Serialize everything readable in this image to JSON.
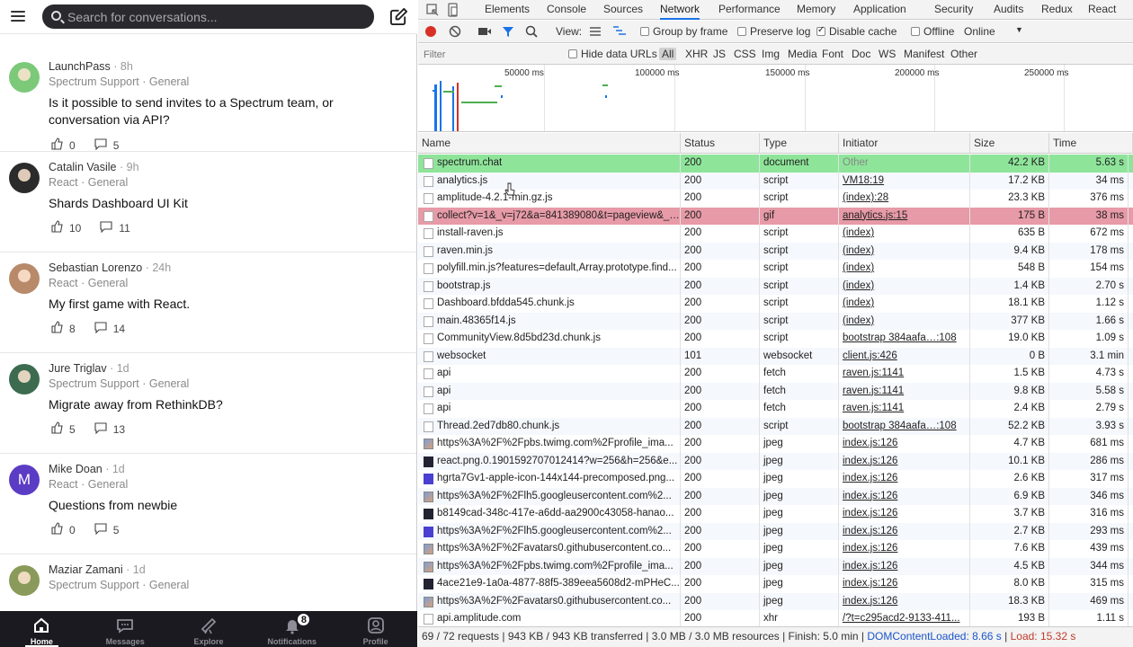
{
  "app": {
    "search_placeholder": "Search for conversations...",
    "threads": [
      {
        "author": "LaunchPass",
        "ago": "8h",
        "channel": "Spectrum Support · General",
        "title": "Is it possible to send invites to a Spectrum team, or conversation via API?",
        "likes": "0",
        "comments": "5",
        "avatar_color": "#7cc97a"
      },
      {
        "author": "Catalin Vasile",
        "ago": "9h",
        "channel": "React · General",
        "title": "Shards Dashboard UI Kit",
        "likes": "10",
        "comments": "11",
        "avatar_color": "#2b2b2b"
      },
      {
        "author": "Sebastian Lorenzo",
        "ago": "24h",
        "channel": "React · General",
        "title": "My first game with React.",
        "likes": "8",
        "comments": "14",
        "avatar_color": "#b88a6a"
      },
      {
        "author": "Jure Triglav",
        "ago": "1d",
        "channel": "Spectrum Support · General",
        "title": "Migrate away from RethinkDB?",
        "likes": "5",
        "comments": "13",
        "avatar_color": "#3d6b4f"
      },
      {
        "author": "Mike Doan",
        "ago": "1d",
        "channel": "React · General",
        "title": "Questions from newbie",
        "likes": "0",
        "comments": "5",
        "avatar_color": "#5b3cc4",
        "initial": "M"
      },
      {
        "author": "Maziar Zamani",
        "ago": "1d",
        "channel": "Spectrum Support · General",
        "title": "",
        "likes": "",
        "comments": "",
        "avatar_color": "#8a9a5a"
      }
    ],
    "nav": [
      {
        "label": "Home",
        "icon": "home-icon"
      },
      {
        "label": "Messages",
        "icon": "messages-icon"
      },
      {
        "label": "Explore",
        "icon": "explore-icon"
      },
      {
        "label": "Notifications",
        "icon": "notifications-icon",
        "badge": "8"
      },
      {
        "label": "Profile",
        "icon": "profile-icon"
      }
    ]
  },
  "devtools": {
    "tabs": [
      "Elements",
      "Console",
      "Sources",
      "Network",
      "Performance",
      "Memory",
      "Application",
      "Security",
      "Audits",
      "Redux",
      "React"
    ],
    "active_tab": "Network",
    "toolbar": {
      "view_label": "View:",
      "group_by_frame": "Group by frame",
      "preserve_log": "Preserve log",
      "disable_cache": "Disable cache",
      "offline": "Offline",
      "throttle": "Online"
    },
    "filter": {
      "placeholder": "Filter",
      "hide_data_urls": "Hide data URLs",
      "types": [
        "All",
        "XHR",
        "JS",
        "CSS",
        "Img",
        "Media",
        "Font",
        "Doc",
        "WS",
        "Manifest",
        "Other"
      ]
    },
    "overview_ticks": [
      "50000 ms",
      "100000 ms",
      "150000 ms",
      "200000 ms",
      "250000 ms"
    ],
    "columns": {
      "name": "Name",
      "status": "Status",
      "type": "Type",
      "initiator": "Initiator",
      "size": "Size",
      "time": "Time"
    },
    "rows": [
      {
        "name": "spectrum.chat",
        "status": "200",
        "type": "document",
        "initiator": "Other",
        "size": "42.2 KB",
        "time": "5.63 s",
        "hl": "green"
      },
      {
        "name": "analytics.js",
        "status": "200",
        "type": "script",
        "initiator": "VM18:19",
        "size": "17.2 KB",
        "time": "34 ms"
      },
      {
        "name": "amplitude-4.2.1-min.gz.js",
        "status": "200",
        "type": "script",
        "initiator": "(index):28",
        "size": "23.3 KB",
        "time": "376 ms"
      },
      {
        "name": "collect?v=1&_v=j72&a=841389080&t=pageview&_…",
        "status": "200",
        "type": "gif",
        "initiator": "analytics.js:15",
        "size": "175 B",
        "time": "38 ms",
        "hl": "red"
      },
      {
        "name": "install-raven.js",
        "status": "200",
        "type": "script",
        "initiator": "(index)",
        "size": "635 B",
        "time": "672 ms"
      },
      {
        "name": "raven.min.js",
        "status": "200",
        "type": "script",
        "initiator": "(index)",
        "size": "9.4 KB",
        "time": "178 ms"
      },
      {
        "name": "polyfill.min.js?features=default,Array.prototype.find...",
        "status": "200",
        "type": "script",
        "initiator": "(index)",
        "size": "548 B",
        "time": "154 ms"
      },
      {
        "name": "bootstrap.js",
        "status": "200",
        "type": "script",
        "initiator": "(index)",
        "size": "1.4 KB",
        "time": "2.70 s"
      },
      {
        "name": "Dashboard.bfdda545.chunk.js",
        "status": "200",
        "type": "script",
        "initiator": "(index)",
        "size": "18.1 KB",
        "time": "1.12 s"
      },
      {
        "name": "main.48365f14.js",
        "status": "200",
        "type": "script",
        "initiator": "(index)",
        "size": "377 KB",
        "time": "1.66 s"
      },
      {
        "name": "CommunityView.8d5bd23d.chunk.js",
        "status": "200",
        "type": "script",
        "initiator": "bootstrap 384aafa…:108",
        "size": "19.0 KB",
        "time": "1.09 s"
      },
      {
        "name": "websocket",
        "status": "101",
        "type": "websocket",
        "initiator": "client.js:426",
        "size": "0 B",
        "time": "3.1 min"
      },
      {
        "name": "api",
        "status": "200",
        "type": "fetch",
        "initiator": "raven.js:1141",
        "size": "1.5 KB",
        "time": "4.73 s"
      },
      {
        "name": "api",
        "status": "200",
        "type": "fetch",
        "initiator": "raven.js:1141",
        "size": "9.8 KB",
        "time": "5.58 s"
      },
      {
        "name": "api",
        "status": "200",
        "type": "fetch",
        "initiator": "raven.js:1141",
        "size": "2.4 KB",
        "time": "2.79 s"
      },
      {
        "name": "Thread.2ed7db80.chunk.js",
        "status": "200",
        "type": "script",
        "initiator": "bootstrap 384aafa…:108",
        "size": "52.2 KB",
        "time": "3.93 s"
      },
      {
        "name": "https%3A%2F%2Fpbs.twimg.com%2Fprofile_ima...",
        "status": "200",
        "type": "jpeg",
        "initiator": "index.js:126",
        "size": "4.7 KB",
        "time": "681 ms",
        "icon": "img"
      },
      {
        "name": "react.png.0.1901592707012414?w=256&h=256&e...",
        "status": "200",
        "type": "jpeg",
        "initiator": "index.js:126",
        "size": "10.1 KB",
        "time": "286 ms",
        "icon": "dark"
      },
      {
        "name": "hgrta7Gv1-apple-icon-144x144-precomposed.png...",
        "status": "200",
        "type": "jpeg",
        "initiator": "index.js:126",
        "size": "2.6 KB",
        "time": "317 ms",
        "icon": "blue"
      },
      {
        "name": "https%3A%2F%2Flh5.googleusercontent.com%2...",
        "status": "200",
        "type": "jpeg",
        "initiator": "index.js:126",
        "size": "6.9 KB",
        "time": "346 ms",
        "icon": "img"
      },
      {
        "name": "b8149cad-348c-417e-a6dd-aa2900c43058-hanao...",
        "status": "200",
        "type": "jpeg",
        "initiator": "index.js:126",
        "size": "3.7 KB",
        "time": "316 ms",
        "icon": "dark"
      },
      {
        "name": "https%3A%2F%2Flh5.googleusercontent.com%2...",
        "status": "200",
        "type": "jpeg",
        "initiator": "index.js:126",
        "size": "2.7 KB",
        "time": "293 ms",
        "icon": "blue"
      },
      {
        "name": "https%3A%2F%2Favatars0.githubusercontent.co...",
        "status": "200",
        "type": "jpeg",
        "initiator": "index.js:126",
        "size": "7.6 KB",
        "time": "439 ms",
        "icon": "img"
      },
      {
        "name": "https%3A%2F%2Fpbs.twimg.com%2Fprofile_ima...",
        "status": "200",
        "type": "jpeg",
        "initiator": "index.js:126",
        "size": "4.5 KB",
        "time": "344 ms",
        "icon": "img"
      },
      {
        "name": "4ace21e9-1a0a-4877-88f5-389eea5608d2-mPHeC...",
        "status": "200",
        "type": "jpeg",
        "initiator": "index.js:126",
        "size": "8.0 KB",
        "time": "315 ms",
        "icon": "dark"
      },
      {
        "name": "https%3A%2F%2Favatars0.githubusercontent.co...",
        "status": "200",
        "type": "jpeg",
        "initiator": "index.js:126",
        "size": "18.3 KB",
        "time": "469 ms",
        "icon": "img"
      },
      {
        "name": "api.amplitude.com",
        "status": "200",
        "type": "xhr",
        "initiator": "/?t=c295acd2-9133-411...",
        "size": "193 B",
        "time": "1.11 s"
      }
    ],
    "status_bar": {
      "summary": "69 / 72 requests | 943 KB / 943 KB transferred | 3.0 MB / 3.0 MB resources | Finish: 5.0 min | ",
      "dcl": "DOMContentLoaded: 8.66 s",
      "sep": " | ",
      "load": "Load: 15.32 s"
    }
  }
}
